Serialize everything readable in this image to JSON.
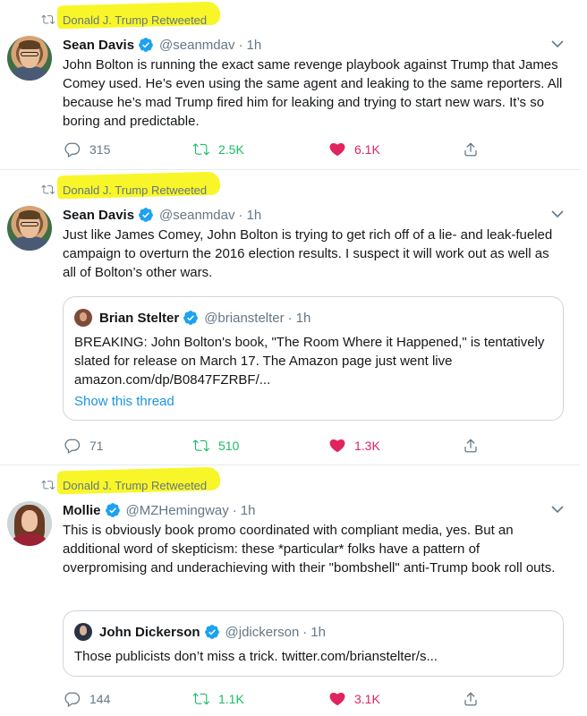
{
  "colors": {
    "verified": "#1da1f2",
    "retweet_green": "#17bf63",
    "like_red": "#e0245e",
    "link_blue": "#1b95e0",
    "highlight_yellow": "#f8f628"
  },
  "tweets": [
    {
      "retweeted_by": "Donald J. Trump Retweeted",
      "name": "Sean Davis",
      "handle": "@seanmdav",
      "separator": "·",
      "time": "1h",
      "text": "John Bolton is running the exact same revenge playbook against Trump that James Comey used. He’s even using the same agent and leaking to the same reporters. All because he’s mad Trump fired him for leaking and trying to start new wars. It’s so boring and predictable.",
      "replies": "315",
      "retweets": "2.5K",
      "likes": "6.1K"
    },
    {
      "retweeted_by": "Donald J. Trump Retweeted",
      "name": "Sean Davis",
      "handle": "@seanmdav",
      "separator": "·",
      "time": "1h",
      "text": "Just like James Comey, John Bolton is trying to get rich off of a lie- and leak-fueled campaign to overturn the 2016 election results. I suspect it will work out as well as all of Bolton’s other wars.",
      "quote": {
        "name": "Brian Stelter",
        "handle": "@brianstelter",
        "separator": "·",
        "time": "1h",
        "text": "BREAKING: John Bolton's book, \"The Room Where it Happened,\" is tentatively slated for release on March 17. The Amazon page just went live amazon.com/dp/B0847FZRBF/...",
        "show_thread": "Show this thread"
      },
      "replies": "71",
      "retweets": "510",
      "likes": "1.3K"
    },
    {
      "retweeted_by": "Donald J. Trump Retweeted",
      "name": "Mollie",
      "handle": "@MZHemingway",
      "separator": "·",
      "time": "1h",
      "text": "This is obviously book promo coordinated with compliant media, yes. But an additional word of skepticism: these *particular* folks have a pattern of overpromising and underachieving with their \"bombshell\" anti-Trump book roll outs.",
      "quote": {
        "name": "John Dickerson",
        "handle": "@jdickerson",
        "separator": "·",
        "time": "1h",
        "text": "Those publicists don’t miss a trick. twitter.com/brianstelter/s..."
      },
      "replies": "144",
      "retweets": "1.1K",
      "likes": "3.1K"
    }
  ]
}
